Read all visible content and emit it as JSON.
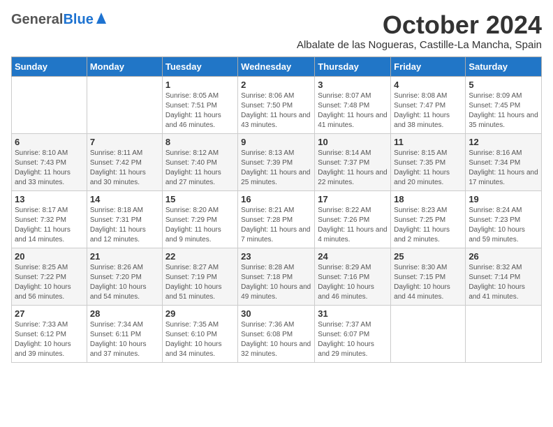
{
  "header": {
    "logo_general": "General",
    "logo_blue": "Blue",
    "month": "October 2024",
    "location": "Albalate de las Nogueras, Castille-La Mancha, Spain"
  },
  "days_of_week": [
    "Sunday",
    "Monday",
    "Tuesday",
    "Wednesday",
    "Thursday",
    "Friday",
    "Saturday"
  ],
  "weeks": [
    [
      {
        "day": "",
        "info": ""
      },
      {
        "day": "",
        "info": ""
      },
      {
        "day": "1",
        "info": "Sunrise: 8:05 AM\nSunset: 7:51 PM\nDaylight: 11 hours and 46 minutes."
      },
      {
        "day": "2",
        "info": "Sunrise: 8:06 AM\nSunset: 7:50 PM\nDaylight: 11 hours and 43 minutes."
      },
      {
        "day": "3",
        "info": "Sunrise: 8:07 AM\nSunset: 7:48 PM\nDaylight: 11 hours and 41 minutes."
      },
      {
        "day": "4",
        "info": "Sunrise: 8:08 AM\nSunset: 7:47 PM\nDaylight: 11 hours and 38 minutes."
      },
      {
        "day": "5",
        "info": "Sunrise: 8:09 AM\nSunset: 7:45 PM\nDaylight: 11 hours and 35 minutes."
      }
    ],
    [
      {
        "day": "6",
        "info": "Sunrise: 8:10 AM\nSunset: 7:43 PM\nDaylight: 11 hours and 33 minutes."
      },
      {
        "day": "7",
        "info": "Sunrise: 8:11 AM\nSunset: 7:42 PM\nDaylight: 11 hours and 30 minutes."
      },
      {
        "day": "8",
        "info": "Sunrise: 8:12 AM\nSunset: 7:40 PM\nDaylight: 11 hours and 27 minutes."
      },
      {
        "day": "9",
        "info": "Sunrise: 8:13 AM\nSunset: 7:39 PM\nDaylight: 11 hours and 25 minutes."
      },
      {
        "day": "10",
        "info": "Sunrise: 8:14 AM\nSunset: 7:37 PM\nDaylight: 11 hours and 22 minutes."
      },
      {
        "day": "11",
        "info": "Sunrise: 8:15 AM\nSunset: 7:35 PM\nDaylight: 11 hours and 20 minutes."
      },
      {
        "day": "12",
        "info": "Sunrise: 8:16 AM\nSunset: 7:34 PM\nDaylight: 11 hours and 17 minutes."
      }
    ],
    [
      {
        "day": "13",
        "info": "Sunrise: 8:17 AM\nSunset: 7:32 PM\nDaylight: 11 hours and 14 minutes."
      },
      {
        "day": "14",
        "info": "Sunrise: 8:18 AM\nSunset: 7:31 PM\nDaylight: 11 hours and 12 minutes."
      },
      {
        "day": "15",
        "info": "Sunrise: 8:20 AM\nSunset: 7:29 PM\nDaylight: 11 hours and 9 minutes."
      },
      {
        "day": "16",
        "info": "Sunrise: 8:21 AM\nSunset: 7:28 PM\nDaylight: 11 hours and 7 minutes."
      },
      {
        "day": "17",
        "info": "Sunrise: 8:22 AM\nSunset: 7:26 PM\nDaylight: 11 hours and 4 minutes."
      },
      {
        "day": "18",
        "info": "Sunrise: 8:23 AM\nSunset: 7:25 PM\nDaylight: 11 hours and 2 minutes."
      },
      {
        "day": "19",
        "info": "Sunrise: 8:24 AM\nSunset: 7:23 PM\nDaylight: 10 hours and 59 minutes."
      }
    ],
    [
      {
        "day": "20",
        "info": "Sunrise: 8:25 AM\nSunset: 7:22 PM\nDaylight: 10 hours and 56 minutes."
      },
      {
        "day": "21",
        "info": "Sunrise: 8:26 AM\nSunset: 7:20 PM\nDaylight: 10 hours and 54 minutes."
      },
      {
        "day": "22",
        "info": "Sunrise: 8:27 AM\nSunset: 7:19 PM\nDaylight: 10 hours and 51 minutes."
      },
      {
        "day": "23",
        "info": "Sunrise: 8:28 AM\nSunset: 7:18 PM\nDaylight: 10 hours and 49 minutes."
      },
      {
        "day": "24",
        "info": "Sunrise: 8:29 AM\nSunset: 7:16 PM\nDaylight: 10 hours and 46 minutes."
      },
      {
        "day": "25",
        "info": "Sunrise: 8:30 AM\nSunset: 7:15 PM\nDaylight: 10 hours and 44 minutes."
      },
      {
        "day": "26",
        "info": "Sunrise: 8:32 AM\nSunset: 7:14 PM\nDaylight: 10 hours and 41 minutes."
      }
    ],
    [
      {
        "day": "27",
        "info": "Sunrise: 7:33 AM\nSunset: 6:12 PM\nDaylight: 10 hours and 39 minutes."
      },
      {
        "day": "28",
        "info": "Sunrise: 7:34 AM\nSunset: 6:11 PM\nDaylight: 10 hours and 37 minutes."
      },
      {
        "day": "29",
        "info": "Sunrise: 7:35 AM\nSunset: 6:10 PM\nDaylight: 10 hours and 34 minutes."
      },
      {
        "day": "30",
        "info": "Sunrise: 7:36 AM\nSunset: 6:08 PM\nDaylight: 10 hours and 32 minutes."
      },
      {
        "day": "31",
        "info": "Sunrise: 7:37 AM\nSunset: 6:07 PM\nDaylight: 10 hours and 29 minutes."
      },
      {
        "day": "",
        "info": ""
      },
      {
        "day": "",
        "info": ""
      }
    ]
  ]
}
